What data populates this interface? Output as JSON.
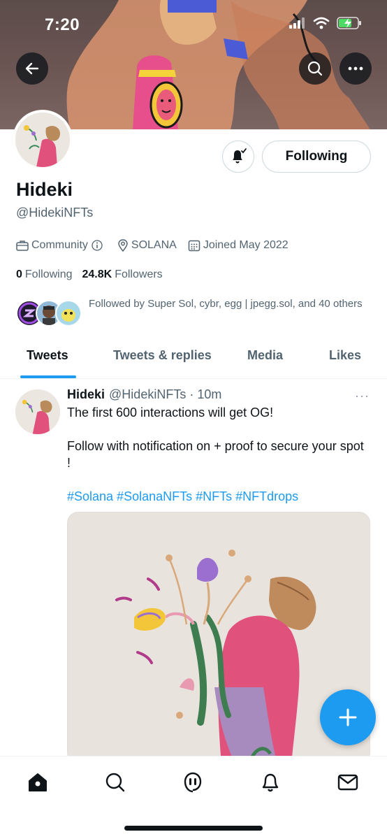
{
  "status_bar": {
    "time": "7:20"
  },
  "header": {
    "back_icon": "arrow-left-icon",
    "search_icon": "search-icon",
    "more_icon": "more-horizontal-icon"
  },
  "profile": {
    "name": "Hideki",
    "handle": "@HidekiNFTs",
    "following_button": "Following",
    "meta": {
      "category": "Community",
      "location": "SOLANA",
      "joined": "Joined May 2022"
    },
    "counts": {
      "following_count": "0",
      "following_label": "Following",
      "followers_count": "24.8K",
      "followers_label": "Followers"
    },
    "followed_by": "Followed by Super Sol, cybr, egg | jpegg.sol, and 40 others"
  },
  "tabs": [
    {
      "label": "Tweets",
      "active": true
    },
    {
      "label": "Tweets & replies",
      "active": false
    },
    {
      "label": "Media",
      "active": false
    },
    {
      "label": "Likes",
      "active": false
    }
  ],
  "tweet": {
    "author": "Hideki",
    "handle_time": "@HidekiNFTs · 10m",
    "more": "···",
    "line1": "The first 600 interactions will get OG!",
    "line2": "Follow with notification on + proof to secure your spot !",
    "hashtags": "#Solana #SolanaNFTs #NFTs #NFTdrops"
  },
  "fab": {
    "icon": "plus-icon"
  },
  "bottom_nav": [
    "home-icon",
    "search-icon",
    "spaces-icon",
    "notifications-icon",
    "messages-icon"
  ],
  "colors": {
    "accent": "#1d9bf0",
    "text": "#0f1419",
    "muted": "#536471"
  }
}
